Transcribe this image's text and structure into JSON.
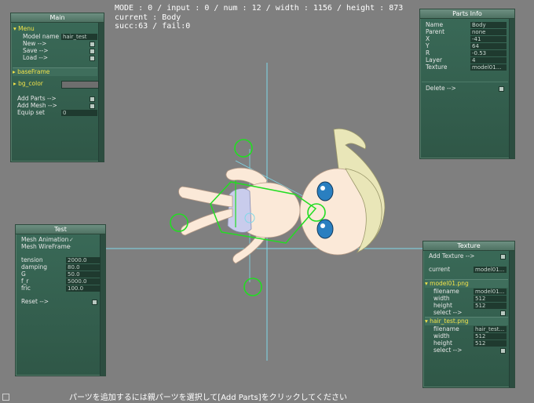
{
  "hud": {
    "line1": "MODE : 0 / input : 0 / num : 12 / width : 1156 / height : 873",
    "line2": "current : Body",
    "line3": "succ:63 / fail:0"
  },
  "footer": "パーツを追加するには親パーツを選択して[Add Parts]をクリックしてください",
  "main_panel": {
    "title": "Main",
    "menu_label": "Menu",
    "model_name_label": "Model name",
    "model_name_value": "hair_test",
    "new": "New   -->",
    "save": "Save   -->",
    "load": "Load   -->",
    "base_frame": "baseFrame",
    "bg_color": "bg_color",
    "add_parts": "Add Parts -->",
    "add_mesh": "Add Mesh -->",
    "equip_set_label": "Equip set",
    "equip_set_value": "0"
  },
  "parts_panel": {
    "title": "Parts Info",
    "rows": [
      {
        "label": "Name",
        "value": "Body"
      },
      {
        "label": "Parent",
        "value": "none"
      },
      {
        "label": "X",
        "value": "-41"
      },
      {
        "label": "Y",
        "value": "64"
      },
      {
        "label": "R",
        "value": "-0.53"
      },
      {
        "label": "Layer",
        "value": "4"
      },
      {
        "label": "Texture",
        "value": "model01..."
      }
    ],
    "delete": "Delete   -->"
  },
  "test_panel": {
    "title": "Test",
    "mesh_animation_label": "Mesh Animation",
    "mesh_animation_value": "✓",
    "mesh_wireframe_label": "Mesh WireFrame",
    "mesh_wireframe_value": "-",
    "params": [
      {
        "label": "tension",
        "value": "2000.0"
      },
      {
        "label": "damping",
        "value": "80.0"
      },
      {
        "label": "G",
        "value": "50.0"
      },
      {
        "label": "f_r",
        "value": "5000.0"
      },
      {
        "label": "fric",
        "value": "100.0"
      }
    ],
    "reset": "Reset   -->"
  },
  "texture_panel": {
    "title": "Texture",
    "add_texture": "Add Texture -->",
    "current_label": "current",
    "current_value": "model01...",
    "textures": [
      {
        "name": "model01.png",
        "filename": "model01...",
        "width": "512",
        "height": "512",
        "select": "select -->"
      },
      {
        "name": "hair_test.png",
        "filename": "hair_test...",
        "width": "512",
        "height": "512",
        "select": "select -->"
      }
    ],
    "filename_label": "filename",
    "width_label": "width",
    "height_label": "height"
  },
  "colors": {
    "panel_bg": "#2f5747",
    "accent_yellow": "#f0e24a",
    "handle_green": "#22dd22",
    "axis_cyan": "#7fd8e8"
  }
}
